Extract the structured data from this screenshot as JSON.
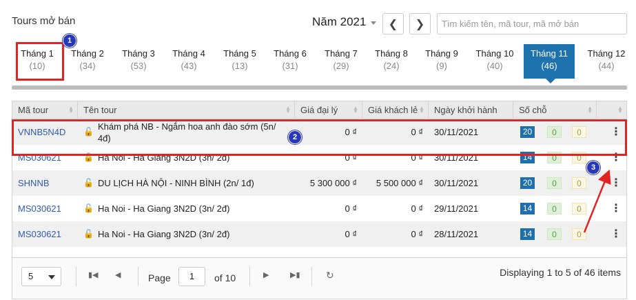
{
  "header": {
    "title": "Tours mở bán",
    "year_label": "Năm 2021",
    "prev_icon": "chevron-left-icon",
    "next_icon": "chevron-right-icon",
    "search_placeholder": "Tìm kiếm tên, mã tour, mã mở bán"
  },
  "months": [
    {
      "label": "Tháng 1",
      "count": "(10)"
    },
    {
      "label": "Tháng 2",
      "count": "(34)"
    },
    {
      "label": "Tháng 3",
      "count": "(53)"
    },
    {
      "label": "Tháng 4",
      "count": "(43)"
    },
    {
      "label": "Tháng 5",
      "count": "(13)"
    },
    {
      "label": "Tháng 6",
      "count": "(31)"
    },
    {
      "label": "Tháng 7",
      "count": "(29)"
    },
    {
      "label": "Tháng 8",
      "count": "(24)"
    },
    {
      "label": "Tháng 9",
      "count": "(9)"
    },
    {
      "label": "Tháng 10",
      "count": "(40)"
    },
    {
      "label": "Tháng 11",
      "count": "(46)"
    },
    {
      "label": "Tháng 12",
      "count": "(44)"
    }
  ],
  "active_month": "Tháng 11",
  "annotations": {
    "badge1": "1",
    "badge2": "2",
    "badge3": "3"
  },
  "columns": [
    "Mã tour",
    "Tên tour",
    "Giá đại lý",
    "Giá khách lẻ",
    "Ngày khởi hành",
    "Số chỗ"
  ],
  "rows": [
    {
      "code": "VNNB5N4D",
      "name": "Khám phá NB - Ngắm hoa anh đào sớm (5n/ 4đ)",
      "agent_price": "0 ₫",
      "retail_price": "0 ₫",
      "date": "30/11/2021",
      "total": "20",
      "booked": "0",
      "hold": "0"
    },
    {
      "code": "MS030621",
      "name": "Ha Noi - Ha Giang 3N2D (3n/ 2đ)",
      "agent_price": "0 ₫",
      "retail_price": "0 ₫",
      "date": "30/11/2021",
      "total": "14",
      "booked": "0",
      "hold": "0"
    },
    {
      "code": "SHNNB",
      "name": "DU LỊCH HÀ NỘI - NINH BÌNH (2n/ 1đ)",
      "agent_price": "5 300 000 ₫",
      "retail_price": "5 500 000 ₫",
      "date": "30/11/2021",
      "total": "20",
      "booked": "0",
      "hold": "0"
    },
    {
      "code": "MS030621",
      "name": "Ha Noi - Ha Giang 3N2D (3n/ 2đ)",
      "agent_price": "0 ₫",
      "retail_price": "0 ₫",
      "date": "29/11/2021",
      "total": "14",
      "booked": "0",
      "hold": "0"
    },
    {
      "code": "MS030621",
      "name": "Ha Noi - Ha Giang 3N2D (3n/ 2đ)",
      "agent_price": "0 ₫",
      "retail_price": "0 ₫",
      "date": "28/11/2021",
      "total": "14",
      "booked": "0",
      "hold": "0"
    }
  ],
  "pager": {
    "page_size": "5",
    "page_label": "Page",
    "page_value": "1",
    "of_label": "of 10",
    "display_text": "Displaying 1 to 5 of 46 items"
  },
  "colors": {
    "accent": "#1e72ad",
    "annotation": "#e02424",
    "badge": "#2838b8",
    "link": "#2f5bb7"
  }
}
